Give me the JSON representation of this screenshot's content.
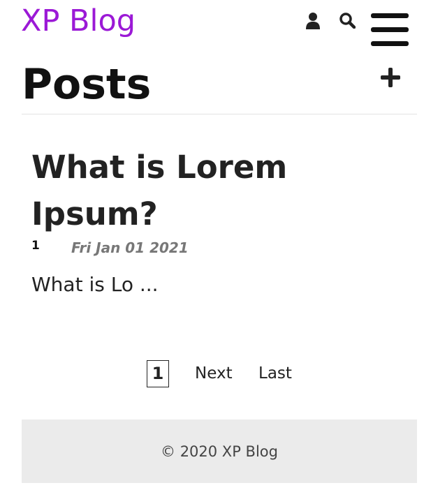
{
  "header": {
    "brand": "XP Blog",
    "icons": {
      "user": "user-icon",
      "search": "search-icon",
      "menu": "hamburger-menu-icon"
    },
    "brand_color": "#9b19d6"
  },
  "page": {
    "title": "Posts",
    "add_icon": "plus-icon"
  },
  "posts": [
    {
      "title": "What is Lorem Ipsum?",
      "id": "1",
      "date": "Fri Jan 01 2021",
      "excerpt": "What is Lo ..."
    }
  ],
  "pagination": {
    "current": "1",
    "next": "Next",
    "last": "Last"
  },
  "footer": {
    "text": "© 2020 XP Blog"
  }
}
